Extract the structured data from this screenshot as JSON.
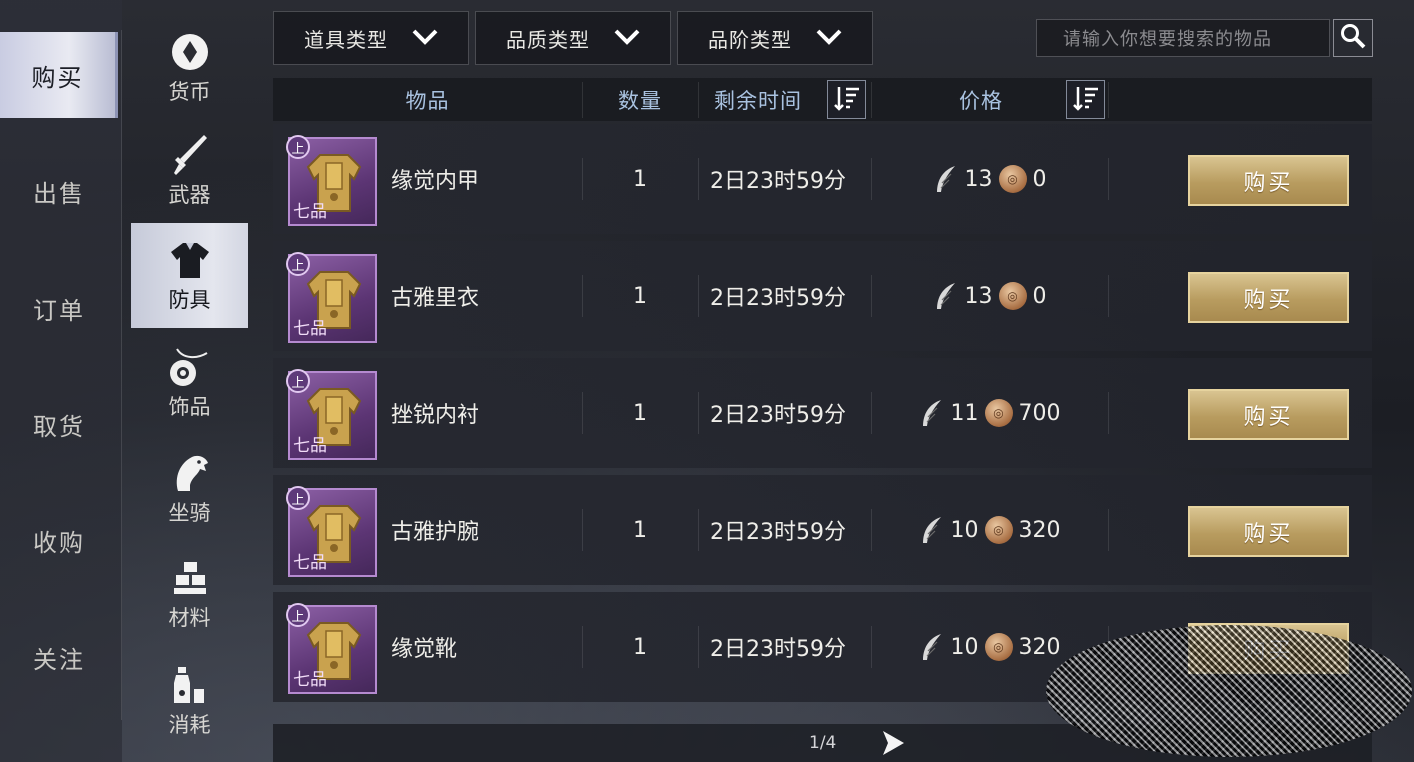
{
  "main_nav": {
    "items": [
      {
        "label": "购买",
        "active": true
      },
      {
        "label": "出售",
        "active": false
      },
      {
        "label": "订单",
        "active": false
      },
      {
        "label": "取货",
        "active": false
      },
      {
        "label": "收购",
        "active": false
      },
      {
        "label": "关注",
        "active": false
      }
    ]
  },
  "categories": [
    {
      "label": "货币",
      "icon": "coin-icon",
      "active": false
    },
    {
      "label": "武器",
      "icon": "sword-icon",
      "active": false
    },
    {
      "label": "防具",
      "icon": "armor-icon",
      "active": true
    },
    {
      "label": "饰品",
      "icon": "ornament-icon",
      "active": false
    },
    {
      "label": "坐骑",
      "icon": "horse-icon",
      "active": false
    },
    {
      "label": "材料",
      "icon": "material-icon",
      "active": false
    },
    {
      "label": "消耗",
      "icon": "potion-icon",
      "active": false
    }
  ],
  "filters": {
    "item_type": "道具类型",
    "quality_type": "品质类型",
    "tier_type": "品阶类型"
  },
  "search": {
    "placeholder": "请输入你想要搜索的物品"
  },
  "table": {
    "headers": {
      "item": "物品",
      "quantity": "数量",
      "time_left": "剩余时间",
      "price": "价格"
    },
    "rows": [
      {
        "name": "缘觉内甲",
        "grade_top": "上",
        "grade_bottom": "七品",
        "quantity": "1",
        "time_left": "2日23时59分",
        "price_a": "13",
        "price_b": "0",
        "buy_label": "购买"
      },
      {
        "name": "古雅里衣",
        "grade_top": "上",
        "grade_bottom": "七品",
        "quantity": "1",
        "time_left": "2日23时59分",
        "price_a": "13",
        "price_b": "0",
        "buy_label": "购买"
      },
      {
        "name": "挫锐内衬",
        "grade_top": "上",
        "grade_bottom": "七品",
        "quantity": "1",
        "time_left": "2日23时59分",
        "price_a": "11",
        "price_b": "700",
        "buy_label": "购买"
      },
      {
        "name": "古雅护腕",
        "grade_top": "上",
        "grade_bottom": "七品",
        "quantity": "1",
        "time_left": "2日23时59分",
        "price_a": "10",
        "price_b": "320",
        "buy_label": "购买"
      },
      {
        "name": "缘觉靴",
        "grade_top": "上",
        "grade_bottom": "七品",
        "quantity": "1",
        "time_left": "2日23时59分",
        "price_a": "10",
        "price_b": "320",
        "buy_label": "购买"
      }
    ]
  },
  "pagination": {
    "page": "1/4"
  },
  "colors": {
    "header_text": "#a9c2e0",
    "buy_button": "#c8ae72",
    "rarity_purple": "#8b5fa4",
    "active_nav": "#e4e6ee"
  }
}
